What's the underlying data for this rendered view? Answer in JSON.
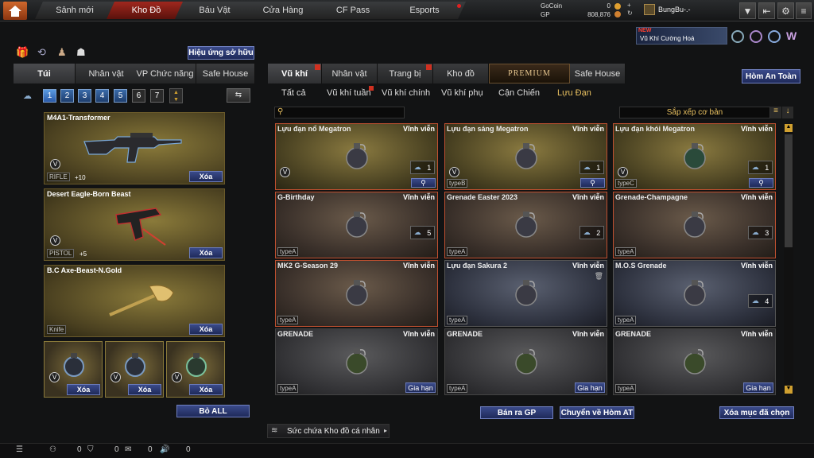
{
  "nav": {
    "tabs": [
      "Sảnh mới",
      "Kho Đồ",
      "Báu Vật",
      "Cửa Hàng",
      "CF Pass",
      "Esports"
    ],
    "active_tab": "Kho Đồ"
  },
  "currency": {
    "gocoin_label": "GoCoin",
    "gocoin_value": "0",
    "gp_label": "GP",
    "gp_value": "808,876"
  },
  "user": {
    "name": "BungBu-.-"
  },
  "promo": {
    "badge": "NEW",
    "text": "Vũ Khí Cường Hoá"
  },
  "left": {
    "effects_button": "Hiệu ứng sở hữu",
    "tabs": [
      "Túi",
      "Nhân vật",
      "VP Chức năng",
      "Safe House"
    ],
    "active_tab": "Túi",
    "pages": [
      "1",
      "2",
      "3",
      "4",
      "5",
      "6",
      "7"
    ],
    "active_page": "1",
    "weapons": [
      {
        "name": "M4A1-Transformer",
        "class": "RIFLE",
        "bonus": "+10",
        "remove": "Xóa"
      },
      {
        "name": "Desert Eagle-Born Beast",
        "class": "PISTOL",
        "bonus": "+5",
        "remove": "Xóa"
      },
      {
        "name": "B.C Axe-Beast-N.Gold",
        "class": "Knife",
        "bonus": "",
        "remove": "Xóa"
      }
    ],
    "small_slots": [
      {
        "remove": "Xóa"
      },
      {
        "remove": "Xóa"
      },
      {
        "remove": "Xóa"
      }
    ],
    "remove_all": "Bỏ ALL"
  },
  "right": {
    "tabs": [
      "Vũ khí",
      "Nhân vật",
      "Trang bị",
      "Kho đồ",
      "PREMIUM",
      "Safe House"
    ],
    "active_tab": "Vũ khí",
    "safe_box_button": "Hòm An Toàn",
    "subtabs": [
      "Tất cả",
      "Vũ khí tuần",
      "Vũ khí chính",
      "Vũ khí phụ",
      "Cận Chiến",
      "Lựu Đạn"
    ],
    "active_subtab": "Lựu Đạn",
    "sort_label": "Sắp xếp cơ bản",
    "items": [
      {
        "name": "Lựu đạn nổ Megatron",
        "duration": "Vĩnh viễn",
        "type": "",
        "count": "1",
        "style": "gold",
        "zoom": true,
        "extend": ""
      },
      {
        "name": "Lựu đạn sáng Megatron",
        "duration": "Vĩnh viễn",
        "type": "typeB",
        "count": "1",
        "style": "gold",
        "zoom": true,
        "extend": ""
      },
      {
        "name": "Lựu đạn khói Megatron",
        "duration": "Vĩnh viễn",
        "type": "typeC",
        "count": "1",
        "style": "gold",
        "zoom": true,
        "extend": ""
      },
      {
        "name": "G-Birthday",
        "duration": "Vĩnh viễn",
        "type": "typeA",
        "count": "5",
        "style": "brown",
        "zoom": false,
        "extend": ""
      },
      {
        "name": "Grenade Easter 2023",
        "duration": "Vĩnh viễn",
        "type": "typeA",
        "count": "2",
        "style": "brown",
        "zoom": false,
        "extend": ""
      },
      {
        "name": "Grenade-Champagne",
        "duration": "Vĩnh viễn",
        "type": "typeA",
        "count": "3",
        "style": "brown",
        "zoom": false,
        "extend": ""
      },
      {
        "name": "MK2 G-Season 29",
        "duration": "Vĩnh viễn",
        "type": "typeA",
        "count": "",
        "style": "brown",
        "zoom": false,
        "extend": ""
      },
      {
        "name": "Lựu đạn Sakura 2",
        "duration": "Vĩnh viễn",
        "type": "typeA",
        "count": "",
        "style": "blue",
        "zoom": false,
        "extend": ""
      },
      {
        "name": "M.O.S Grenade",
        "duration": "Vĩnh viễn",
        "type": "typeA",
        "count": "4",
        "style": "blue",
        "zoom": false,
        "extend": ""
      },
      {
        "name": "GRENADE",
        "duration": "Vĩnh viễn",
        "type": "typeA",
        "count": "",
        "style": "grey",
        "zoom": false,
        "extend": "Gia hạn"
      },
      {
        "name": "GRENADE",
        "duration": "Vĩnh viễn",
        "type": "typeA",
        "count": "",
        "style": "grey",
        "zoom": false,
        "extend": "Gia hạn"
      },
      {
        "name": "GRENADE",
        "duration": "Vĩnh viễn",
        "type": "typeA",
        "count": "",
        "style": "grey",
        "zoom": false,
        "extend": "Gia hạn"
      }
    ],
    "sell_gp": "Bán ra GP",
    "move_to_safe": "Chuyển về Hòm AT",
    "delete_selected": "Xóa mục đã chọn",
    "capacity_label": "Sức chứa Kho đồ cá nhân"
  },
  "status": {
    "v1": "0",
    "v2": "0",
    "v3": "0",
    "v4": "0"
  },
  "colors": {
    "accent_red": "#a0281e",
    "button_blue": "#2a3a7a",
    "gold_text": "#e8c060"
  }
}
